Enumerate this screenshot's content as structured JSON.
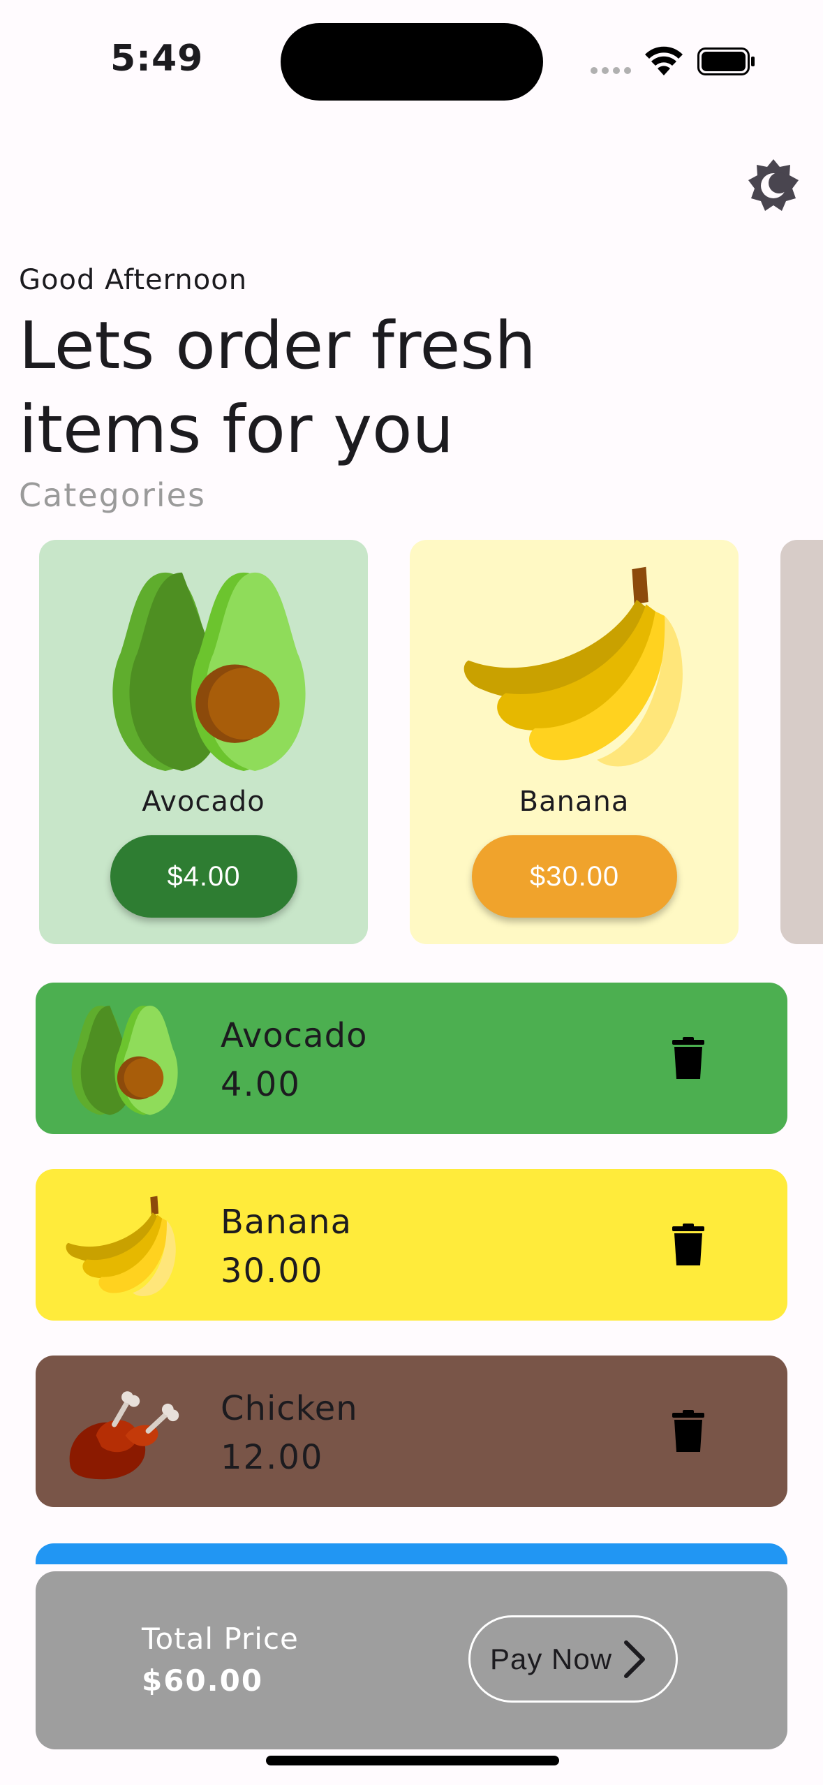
{
  "status_bar": {
    "time": "5:49"
  },
  "header": {
    "greeting": "Good Afternoon",
    "headline": "Lets order fresh items for you",
    "categories_label": "Categories"
  },
  "categories": [
    {
      "name": "Avocado",
      "price": "$4.00",
      "icon": "avocado-icon"
    },
    {
      "name": "Banana",
      "price": "$30.00",
      "icon": "banana-icon"
    }
  ],
  "cart": {
    "items": [
      {
        "name": "Avocado",
        "value": "4.00",
        "color": "#4caf50",
        "icon": "avocado-icon"
      },
      {
        "name": "Banana",
        "value": "30.00",
        "color": "#ffeb3b",
        "icon": "banana-icon"
      },
      {
        "name": "Chicken",
        "value": "12.00",
        "color": "#795548",
        "icon": "chicken-icon"
      }
    ]
  },
  "checkout": {
    "total_label": "Total Price",
    "total_value": "$60.00",
    "pay_label": "Pay Now"
  },
  "colors": {
    "avocado_card": "#c8e6c9",
    "banana_card": "#fff9c4",
    "avocado_button": "#2e7d32",
    "banana_button": "#f0a32c",
    "checkout_bar": "#9e9e9e"
  }
}
